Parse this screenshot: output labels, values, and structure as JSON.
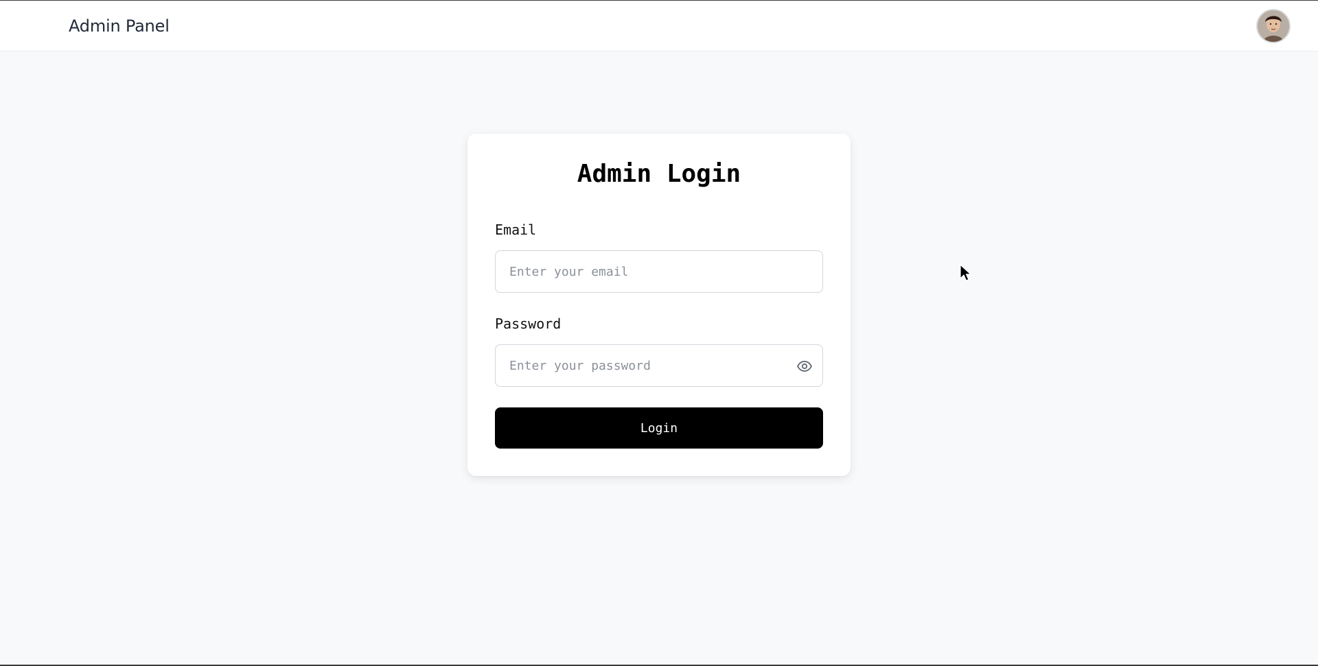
{
  "header": {
    "title": "Admin Panel",
    "avatar_icon": "user-avatar-icon"
  },
  "login": {
    "title": "Admin Login",
    "email_label": "Email",
    "email_placeholder": "Enter your email",
    "email_value": "",
    "password_label": "Password",
    "password_placeholder": "Enter your password",
    "password_value": "",
    "toggle_icon": "eye-icon",
    "submit_label": "Login"
  },
  "colors": {
    "page_background": "#f8f9fb",
    "card_background": "#ffffff",
    "button_background": "#000000",
    "button_text": "#ffffff",
    "input_border": "#d1d5db",
    "placeholder": "#8b9099"
  }
}
